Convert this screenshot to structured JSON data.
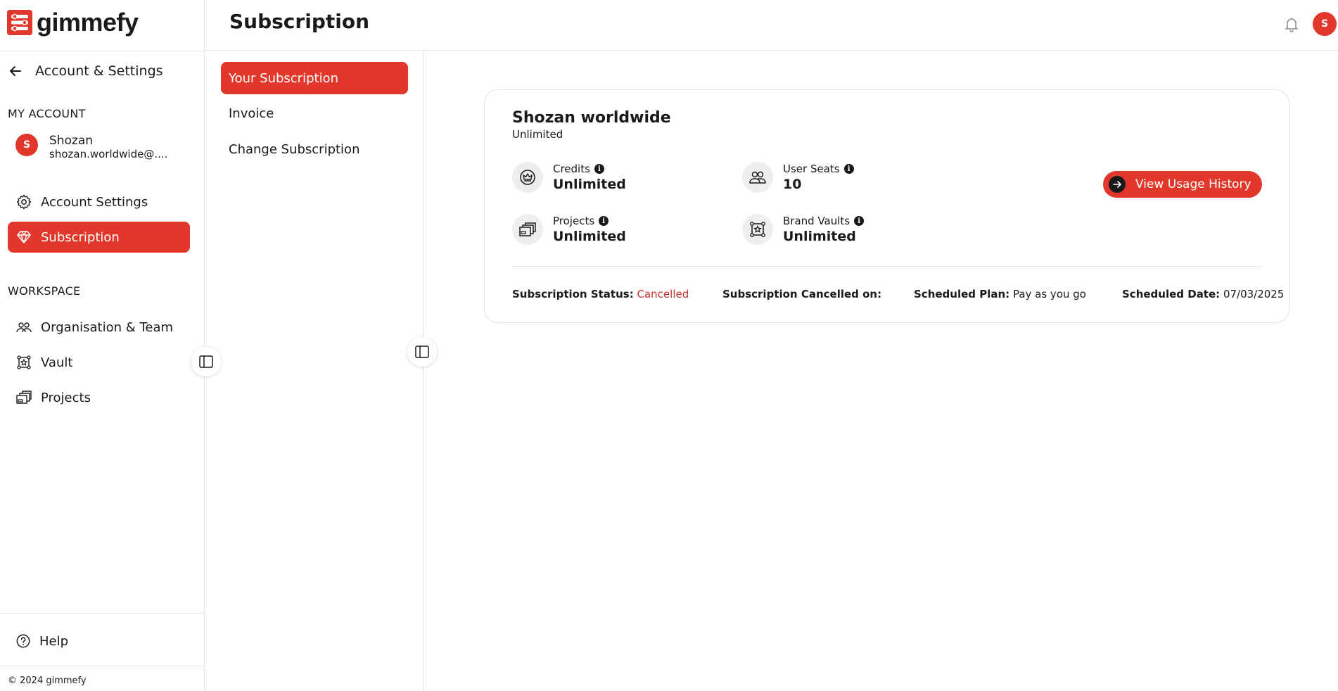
{
  "brand": {
    "name": "gimmefy",
    "accent": "#e2382c"
  },
  "sidebar": {
    "back_label": "Account & Settings",
    "my_account_label": "MY ACCOUNT",
    "user": {
      "initial": "S",
      "name": "Shozan",
      "email": "shozan.worldwide@...."
    },
    "account_items": [
      {
        "label": "Account Settings",
        "icon": "gear-icon"
      },
      {
        "label": "Subscription",
        "icon": "diamond-icon",
        "active": true
      }
    ],
    "workspace_label": "WORKSPACE",
    "workspace_items": [
      {
        "label": "Organisation & Team",
        "icon": "team-icon"
      },
      {
        "label": "Vault",
        "icon": "vault-icon"
      },
      {
        "label": "Projects",
        "icon": "projects-icon"
      }
    ],
    "help_label": "Help",
    "copyright": "© 2024 gimmefy"
  },
  "header": {
    "title": "Subscription",
    "avatar_initial": "S"
  },
  "subnav": {
    "items": [
      {
        "label": "Your Subscription",
        "active": true
      },
      {
        "label": "Invoice"
      },
      {
        "label": "Change Subscription"
      }
    ]
  },
  "card": {
    "org_name": "Shozan worldwide",
    "plan": "Unlimited",
    "stats": {
      "credits": {
        "label": "Credits",
        "value": "Unlimited"
      },
      "user_seats": {
        "label": "User Seats",
        "value": "10"
      },
      "projects": {
        "label": "Projects",
        "value": "Unlimited"
      },
      "brand_vaults": {
        "label": "Brand Vaults",
        "value": "Unlimited"
      }
    },
    "usage_button": "View Usage History",
    "status": {
      "status_label": "Subscription Status:",
      "status_value": "Cancelled",
      "cancelled_on_label": "Subscription Cancelled on:",
      "cancelled_on_value": "",
      "scheduled_plan_label": "Scheduled Plan:",
      "scheduled_plan_value": "Pay as you go",
      "scheduled_date_label": "Scheduled Date:",
      "scheduled_date_value": "07/03/2025"
    }
  }
}
